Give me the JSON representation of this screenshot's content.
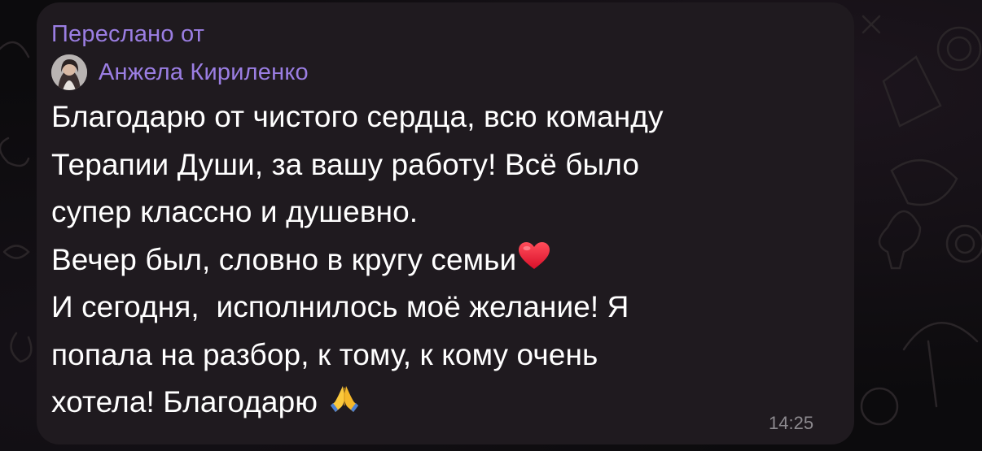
{
  "message": {
    "forward_label": "Переслано от",
    "author_name": "Анжела Кириленко",
    "lines": [
      "Благодарю от чистого сердца, всю команду",
      "Терапии Души, за вашу работу! Всё было",
      "супер классно и душевно.",
      "Вечер был, словно в кругу семьи",
      "И сегодня,  исполнилось моё желание! Я",
      "попала на разбор, к тому, к кому очень",
      "хотела! Благодарю "
    ],
    "time": "14:25",
    "emoji": {
      "line4": "red-heart-icon",
      "line7": "folded-hands-icon"
    }
  },
  "colors": {
    "bubble": "#1f1a1f",
    "accent": "#9b7ee3",
    "text": "#ffffff",
    "time": "#8d8a8f",
    "background": "#0c0b0d"
  }
}
